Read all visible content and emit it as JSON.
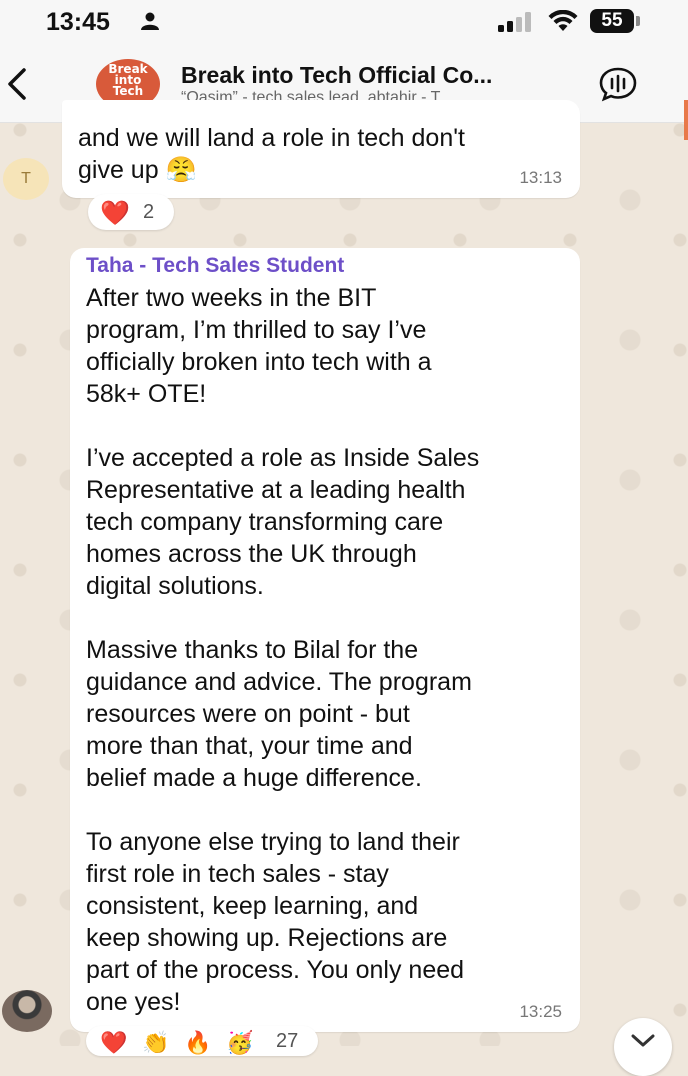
{
  "status_bar": {
    "time": "13:45",
    "battery": "55"
  },
  "header": {
    "title": "Break into Tech Official Co...",
    "subtitle": "“Qasim” - tech sales lead, abtahir - T...",
    "avatar_logo_text": "Break into Tech",
    "icons": [
      "back-chevron-icon",
      "voice-chat-icon"
    ]
  },
  "messages": [
    {
      "sender_avatar_letter": "T",
      "text": "and we will land a role in tech don't\ngive up 😤",
      "time": "13:13",
      "reactions": {
        "emojis": [
          "❤️"
        ],
        "count": "2"
      }
    },
    {
      "sender": "Taha - Tech Sales Student",
      "text": "After two weeks in the BIT\nprogram, I’m thrilled to say I’ve\nofficially broken into tech with a\n58k+ OTE!\n\nI’ve accepted a role as Inside Sales\nRepresentative at a leading health\ntech company transforming care\nhomes across the UK through\ndigital solutions.\n\nMassive thanks to Bilal for the\nguidance and advice. The program\nresources were on point - but\nmore than that, your time and\nbelief made a huge difference.\n\nTo anyone else trying to land their\nfirst role in tech sales - stay\nconsistent, keep learning, and\nkeep showing up. Rejections are\npart of the process. You only need\none yes!",
      "time": "13:25",
      "reactions": {
        "emojis": [
          "❤️",
          "👏",
          "🔥",
          "🥳"
        ],
        "count": "27"
      }
    }
  ],
  "colors": {
    "sender_name": "#6d4fc8",
    "chat_background": "#efe7dc",
    "avatar_brand": "#d85a3a"
  }
}
